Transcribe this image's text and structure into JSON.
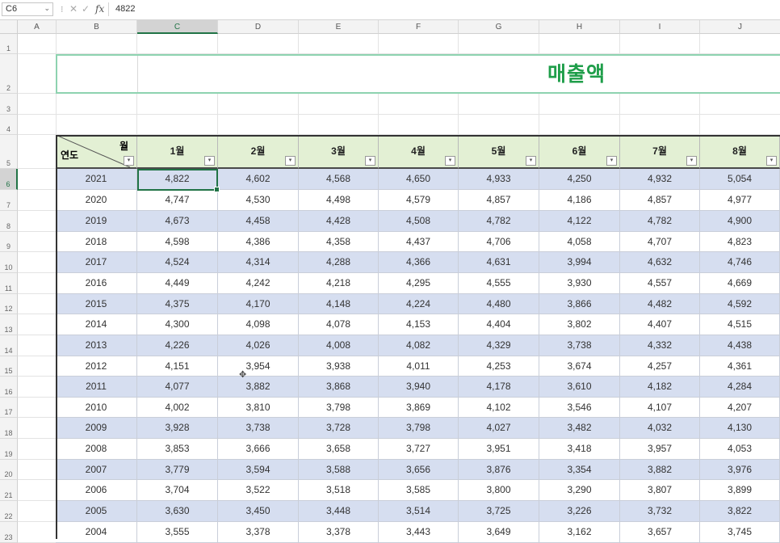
{
  "formula_bar": {
    "name_box": "C6",
    "value": "4822",
    "cancel_icon": "✕",
    "enter_icon": "✓",
    "fx": "fx"
  },
  "columns": [
    "A",
    "B",
    "C",
    "D",
    "E",
    "F",
    "G",
    "H",
    "I",
    "J"
  ],
  "rows": [
    "1",
    "2",
    "3",
    "4",
    "5",
    "6",
    "7",
    "8",
    "9",
    "10",
    "11",
    "12",
    "13",
    "14",
    "15",
    "16",
    "17",
    "18",
    "19",
    "20",
    "21",
    "22",
    "23"
  ],
  "title": "매출액",
  "table": {
    "corner_top": "월",
    "corner_bottom": "연도",
    "headers": [
      "1월",
      "2월",
      "3월",
      "4월",
      "5월",
      "6월",
      "7월",
      "8월"
    ],
    "rows": [
      {
        "year": "2021",
        "values": [
          "4,822",
          "4,602",
          "4,568",
          "4,650",
          "4,933",
          "4,250",
          "4,932",
          "5,054"
        ]
      },
      {
        "year": "2020",
        "values": [
          "4,747",
          "4,530",
          "4,498",
          "4,579",
          "4,857",
          "4,186",
          "4,857",
          "4,977"
        ]
      },
      {
        "year": "2019",
        "values": [
          "4,673",
          "4,458",
          "4,428",
          "4,508",
          "4,782",
          "4,122",
          "4,782",
          "4,900"
        ]
      },
      {
        "year": "2018",
        "values": [
          "4,598",
          "4,386",
          "4,358",
          "4,437",
          "4,706",
          "4,058",
          "4,707",
          "4,823"
        ]
      },
      {
        "year": "2017",
        "values": [
          "4,524",
          "4,314",
          "4,288",
          "4,366",
          "4,631",
          "3,994",
          "4,632",
          "4,746"
        ]
      },
      {
        "year": "2016",
        "values": [
          "4,449",
          "4,242",
          "4,218",
          "4,295",
          "4,555",
          "3,930",
          "4,557",
          "4,669"
        ]
      },
      {
        "year": "2015",
        "values": [
          "4,375",
          "4,170",
          "4,148",
          "4,224",
          "4,480",
          "3,866",
          "4,482",
          "4,592"
        ]
      },
      {
        "year": "2014",
        "values": [
          "4,300",
          "4,098",
          "4,078",
          "4,153",
          "4,404",
          "3,802",
          "4,407",
          "4,515"
        ]
      },
      {
        "year": "2013",
        "values": [
          "4,226",
          "4,026",
          "4,008",
          "4,082",
          "4,329",
          "3,738",
          "4,332",
          "4,438"
        ]
      },
      {
        "year": "2012",
        "values": [
          "4,151",
          "3,954",
          "3,938",
          "4,011",
          "4,253",
          "3,674",
          "4,257",
          "4,361"
        ]
      },
      {
        "year": "2011",
        "values": [
          "4,077",
          "3,882",
          "3,868",
          "3,940",
          "4,178",
          "3,610",
          "4,182",
          "4,284"
        ]
      },
      {
        "year": "2010",
        "values": [
          "4,002",
          "3,810",
          "3,798",
          "3,869",
          "4,102",
          "3,546",
          "4,107",
          "4,207"
        ]
      },
      {
        "year": "2009",
        "values": [
          "3,928",
          "3,738",
          "3,728",
          "3,798",
          "4,027",
          "3,482",
          "4,032",
          "4,130"
        ]
      },
      {
        "year": "2008",
        "values": [
          "3,853",
          "3,666",
          "3,658",
          "3,727",
          "3,951",
          "3,418",
          "3,957",
          "4,053"
        ]
      },
      {
        "year": "2007",
        "values": [
          "3,779",
          "3,594",
          "3,588",
          "3,656",
          "3,876",
          "3,354",
          "3,882",
          "3,976"
        ]
      },
      {
        "year": "2006",
        "values": [
          "3,704",
          "3,522",
          "3,518",
          "3,585",
          "3,800",
          "3,290",
          "3,807",
          "3,899"
        ]
      },
      {
        "year": "2005",
        "values": [
          "3,630",
          "3,450",
          "3,448",
          "3,514",
          "3,725",
          "3,226",
          "3,732",
          "3,822"
        ]
      },
      {
        "year": "2004",
        "values": [
          "3,555",
          "3,378",
          "3,378",
          "3,443",
          "3,649",
          "3,162",
          "3,657",
          "3,745"
        ]
      }
    ]
  },
  "colors": {
    "accent": "#217346",
    "title": "#1f9e4a",
    "header_fill": "#e3f0d4",
    "band_fill": "#d6def0"
  }
}
